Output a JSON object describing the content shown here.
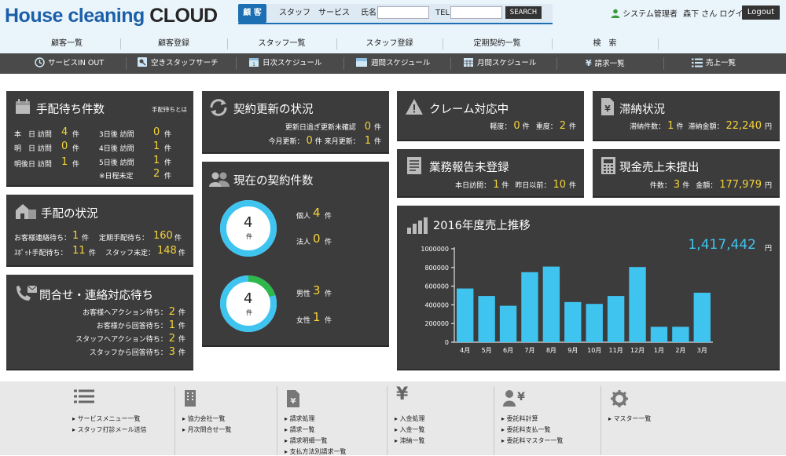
{
  "header": {
    "logo_part1": "House cleaning",
    "logo_part2": "CLOUD",
    "search": {
      "tab_active": "顧 客",
      "tab_staff": "スタッフ",
      "tab_service": "サービス",
      "name_label": "氏名",
      "tel_label": "TEL",
      "name_value": "",
      "tel_value": "",
      "button": "SEARCH"
    },
    "user_role": "システム管理者",
    "user_name": "森下 さん ログイン中",
    "logout": "Logout"
  },
  "nav1": [
    "顧客一覧",
    "顧客登録",
    "スタッフ一覧",
    "スタッフ登録",
    "定期契約一覧",
    "検　索"
  ],
  "nav2": [
    {
      "label": "サービスIN OUT",
      "icon": "clock-icon"
    },
    {
      "label": "空きスタッフサーチ",
      "icon": "user-search-icon"
    },
    {
      "label": "日次スケジュール",
      "icon": "calendar-day-icon"
    },
    {
      "label": "週間スケジュール",
      "icon": "calendar-week-icon"
    },
    {
      "label": "月間スケジュール",
      "icon": "calendar-month-icon"
    },
    {
      "label": "請求一覧",
      "icon": "yen-icon"
    },
    {
      "label": "売上一覧",
      "icon": "list-icon"
    }
  ],
  "arrange_wait": {
    "title": "手配待ち件数",
    "link": "手配待ちとは",
    "rows_left": [
      {
        "label": "本　日 訪問",
        "value": "4",
        "unit": "件"
      },
      {
        "label": "明　日 訪問",
        "value": "0",
        "unit": "件"
      },
      {
        "label": "明後日 訪問",
        "value": "1",
        "unit": "件"
      }
    ],
    "rows_right": [
      {
        "label": "3日後 訪問",
        "value": "0",
        "unit": "件"
      },
      {
        "label": "4日後 訪問",
        "value": "1",
        "unit": "件"
      },
      {
        "label": "5日後 訪問",
        "value": "1",
        "unit": "件"
      },
      {
        "label": "※日程未定",
        "value": "2",
        "unit": "件"
      }
    ]
  },
  "arrange_status": {
    "title": "手配の状況",
    "rows": [
      {
        "l1": "お客様連絡待ち：",
        "v1": "1",
        "u1": "件",
        "l2": "定期手配待ち：",
        "v2": "160",
        "u2": "件"
      },
      {
        "l1": "ｽﾎﾟｯﾄ手配待ち：",
        "v1": "11",
        "u1": "件",
        "l2": "スタッフ未定：",
        "v2": "148",
        "u2": "件"
      }
    ]
  },
  "inquiry": {
    "title": "問合せ・連絡対応待ち",
    "rows": [
      {
        "label": "お客様へアクション待ち：",
        "value": "2",
        "unit": "件"
      },
      {
        "label": "お客様から回答待ち：",
        "value": "1",
        "unit": "件"
      },
      {
        "label": "スタッフへアクション待ち：",
        "value": "2",
        "unit": "件"
      },
      {
        "label": "スタッフから回答待ち：",
        "value": "3",
        "unit": "件"
      }
    ]
  },
  "renewal": {
    "title": "契約更新の状況",
    "row1_label": "更新日過ぎ更新未確認",
    "row1_value": "0",
    "row1_unit": "件",
    "row2_label1": "今月更新：",
    "row2_value1": "0",
    "row2_unit1": "件",
    "row2_label2": "来月更新：",
    "row2_value2": "1",
    "row2_unit2": "件"
  },
  "contracts": {
    "title": "現在の契約件数",
    "ring1": {
      "total": "4",
      "unit": "件",
      "fraction": 1.0,
      "color": "#3fc4f0"
    },
    "ring2": {
      "total": "4",
      "unit": "件",
      "fraction_green": 0.2,
      "color": "#3fc4f0",
      "green": "#2fb84a"
    },
    "personal_label": "個人",
    "personal_value": "4",
    "personal_unit": "件",
    "corp_label": "法人",
    "corp_value": "0",
    "corp_unit": "件",
    "male_label": "男性",
    "male_value": "3",
    "male_unit": "件",
    "female_label": "女性",
    "female_value": "1",
    "female_unit": "件"
  },
  "claim": {
    "title": "クレーム対応中",
    "l1": "軽度：",
    "v1": "0",
    "u1": "件",
    "l2": "重度：",
    "v2": "2",
    "u2": "件"
  },
  "overdue": {
    "title": "滞納状況",
    "l1": "滞納件数：",
    "v1": "1",
    "u1": "件",
    "l2": "滞納金額：",
    "v2": "22,240",
    "u2": "円"
  },
  "report": {
    "title": "業務報告未登録",
    "l1": "本日訪問：",
    "v1": "1",
    "u1": "件",
    "l2": "昨日以前：",
    "v2": "10",
    "u2": "件"
  },
  "cash": {
    "title": "現金売上未提出",
    "l1": "件数：",
    "v1": "3",
    "u1": "件",
    "l2": "金額：",
    "v2": "177,979",
    "u2": "円"
  },
  "sales": {
    "title": "2016年度売上推移",
    "total": "1,417,442",
    "total_unit": "円"
  },
  "chart_data": {
    "type": "bar",
    "title": "2016年度売上推移",
    "categories": [
      "4月",
      "5月",
      "6月",
      "7月",
      "8月",
      "9月",
      "10月",
      "11月",
      "12月",
      "1月",
      "2月",
      "3月"
    ],
    "values": [
      575000,
      495000,
      390000,
      750000,
      810000,
      430000,
      410000,
      495000,
      805000,
      165000,
      165000,
      530000
    ],
    "ylim": [
      0,
      1000000
    ],
    "yticks": [
      "1000000",
      "800000",
      "600000",
      "400000",
      "200000",
      "0"
    ],
    "bar_color": "#3fc4f0",
    "grid": false
  },
  "footer": [
    {
      "icon": "list-icon",
      "links": [
        "サービスメニュー一覧",
        "スタッフ打診メール送信"
      ]
    },
    {
      "icon": "building-icon",
      "links": [
        "協力会社一覧",
        "月次問合せ一覧"
      ]
    },
    {
      "icon": "invoice-icon",
      "links": [
        "請求処理",
        "請求一覧",
        "請求明細一覧",
        "支払方法別請求一覧"
      ]
    },
    {
      "icon": "yen-icon",
      "links": [
        "入金処理",
        "入金一覧",
        "滞納一覧"
      ]
    },
    {
      "icon": "user-yen-icon",
      "links": [
        "委託料計算",
        "委託料支払一覧",
        "委託料マスター一覧"
      ]
    },
    {
      "icon": "gear-icon",
      "links": [
        "マスター一覧"
      ]
    }
  ]
}
